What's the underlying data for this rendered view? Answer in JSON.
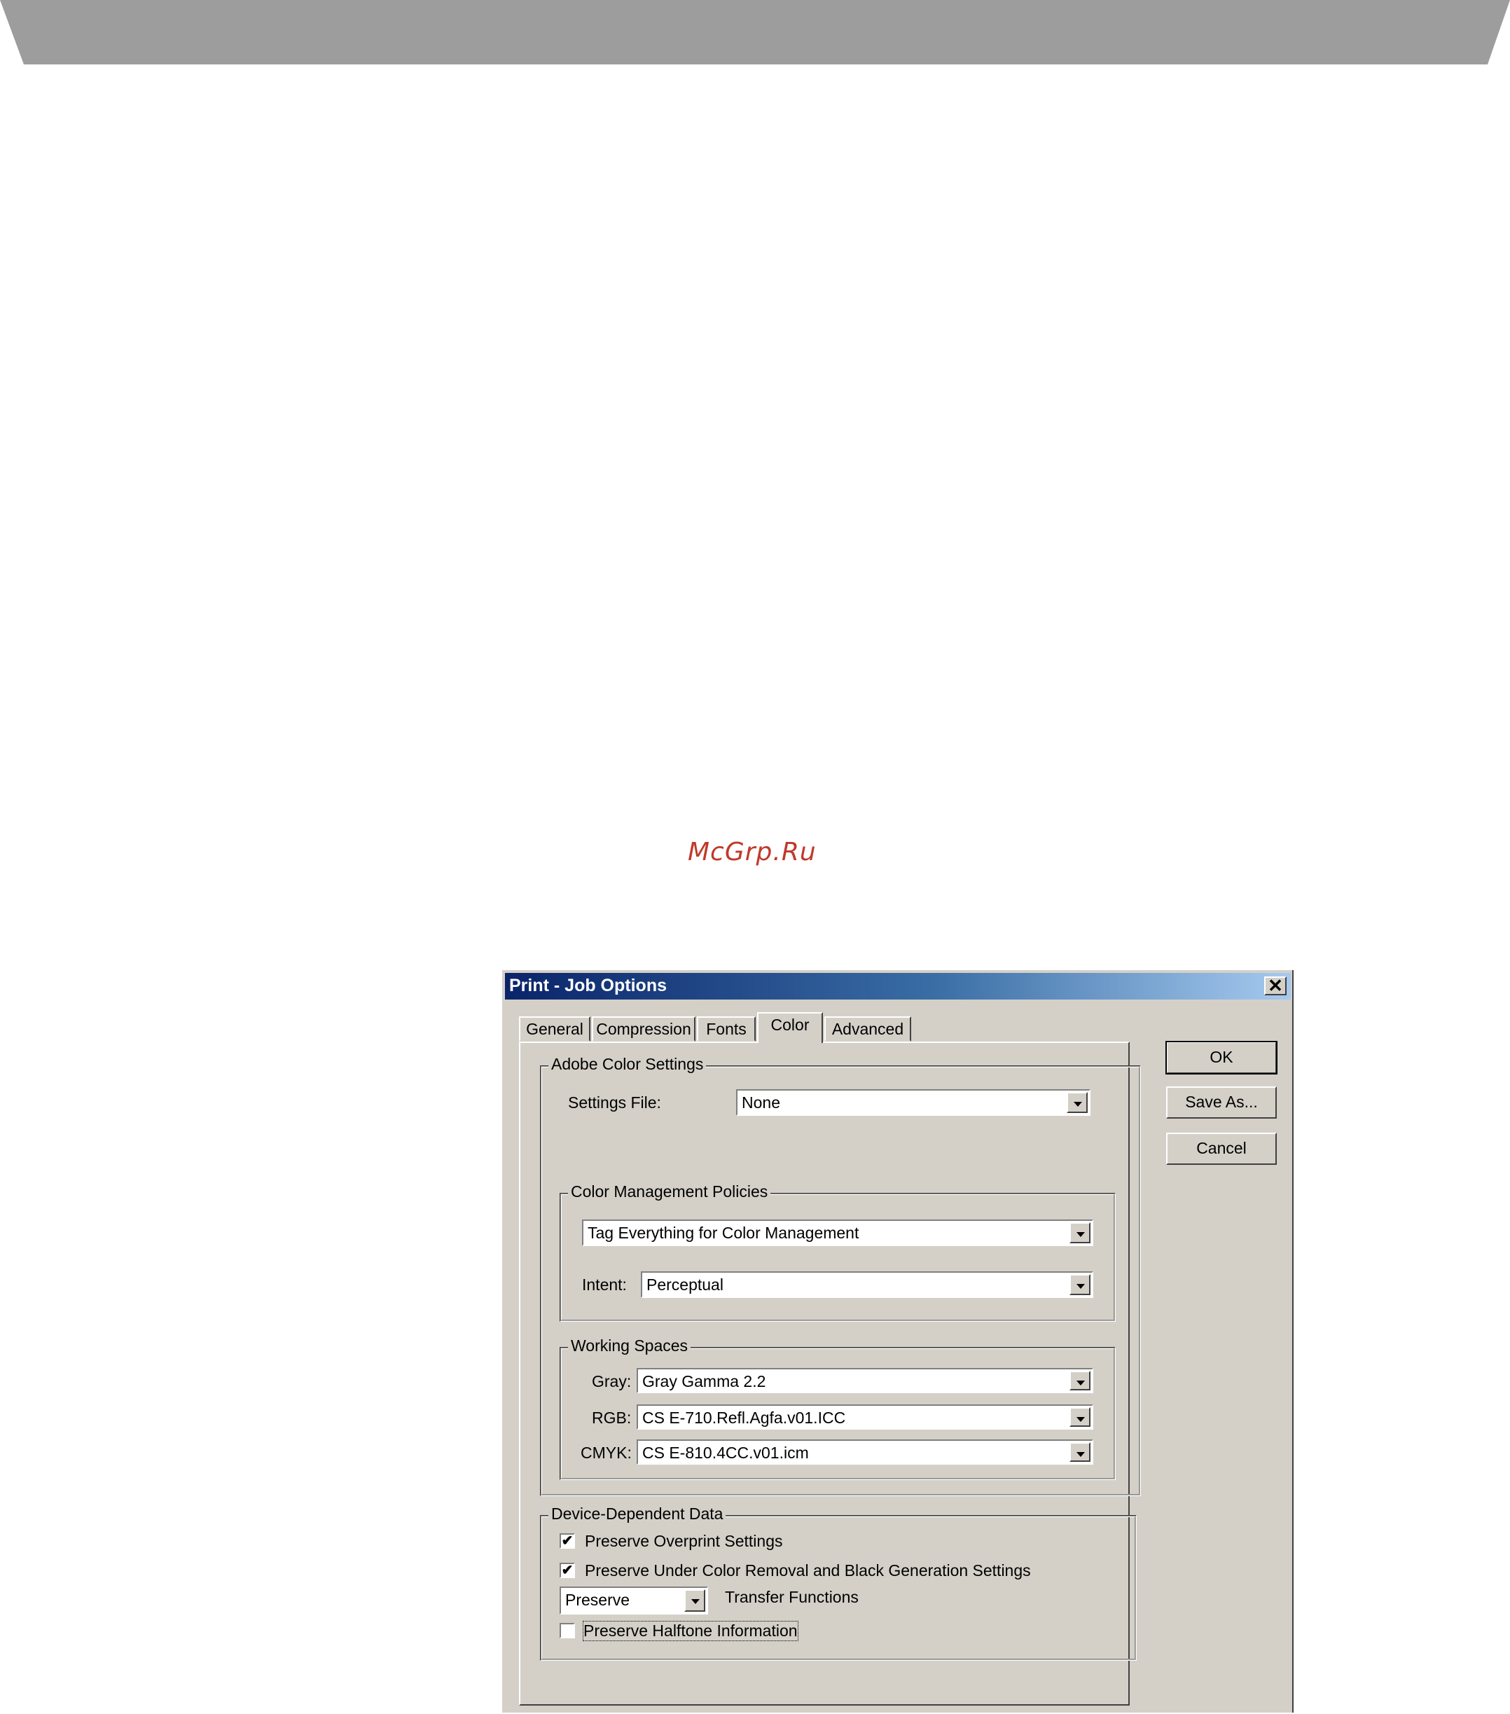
{
  "page": {
    "watermark": "McGrp.Ru"
  },
  "dialog": {
    "title": "Print - Job Options",
    "close_label": "✕",
    "tabs": [
      {
        "label": "General"
      },
      {
        "label": "Compression"
      },
      {
        "label": "Fonts"
      },
      {
        "label": "Color"
      },
      {
        "label": "Advanced"
      }
    ],
    "active_tab": "Color",
    "buttons": {
      "ok": "OK",
      "save_as": "Save As...",
      "cancel": "Cancel"
    }
  },
  "adobe_color_settings": {
    "legend": "Adobe Color Settings",
    "settings_file_label": "Settings File:",
    "settings_file_value": "None"
  },
  "color_management_policies": {
    "legend": "Color Management Policies",
    "policy_value": "Tag Everything for Color Management",
    "intent_label": "Intent:",
    "intent_value": "Perceptual"
  },
  "working_spaces": {
    "legend": "Working Spaces",
    "gray_label": "Gray:",
    "gray_value": "Gray Gamma 2.2",
    "rgb_label": "RGB:",
    "rgb_value": "CS E-710.Refl.Agfa.v01.ICC",
    "cmyk_label": "CMYK:",
    "cmyk_value": "CS E-810.4CC.v01.icm"
  },
  "device_dependent_data": {
    "legend": "Device-Dependent Data",
    "preserve_overprint_label": "Preserve Overprint Settings",
    "preserve_overprint_checked": true,
    "preserve_ucr_label": "Preserve Under Color Removal and Black Generation Settings",
    "preserve_ucr_checked": true,
    "transfer_value": "Preserve",
    "transfer_label": "Transfer Functions",
    "preserve_halftone_label": "Preserve Halftone Information",
    "preserve_halftone_checked": false,
    "check_mark": "✔"
  }
}
